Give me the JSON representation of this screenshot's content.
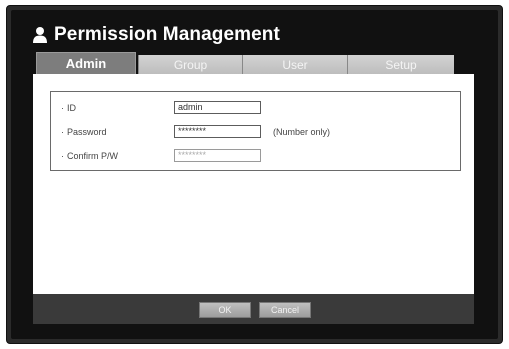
{
  "window": {
    "title": "Permission Management",
    "title_icon": "user-icon"
  },
  "tabs": [
    {
      "label": "Admin",
      "active": true
    },
    {
      "label": "Group",
      "active": false
    },
    {
      "label": "User",
      "active": false
    },
    {
      "label": "Setup",
      "active": false
    }
  ],
  "form": {
    "id": {
      "label": "ID",
      "value": "admin"
    },
    "password": {
      "label": "Password",
      "value": "********",
      "hint": "(Number only)"
    },
    "confirm": {
      "label": "Confirm P/W",
      "value": "********"
    }
  },
  "buttons": {
    "ok": "OK",
    "cancel": "Cancel"
  }
}
